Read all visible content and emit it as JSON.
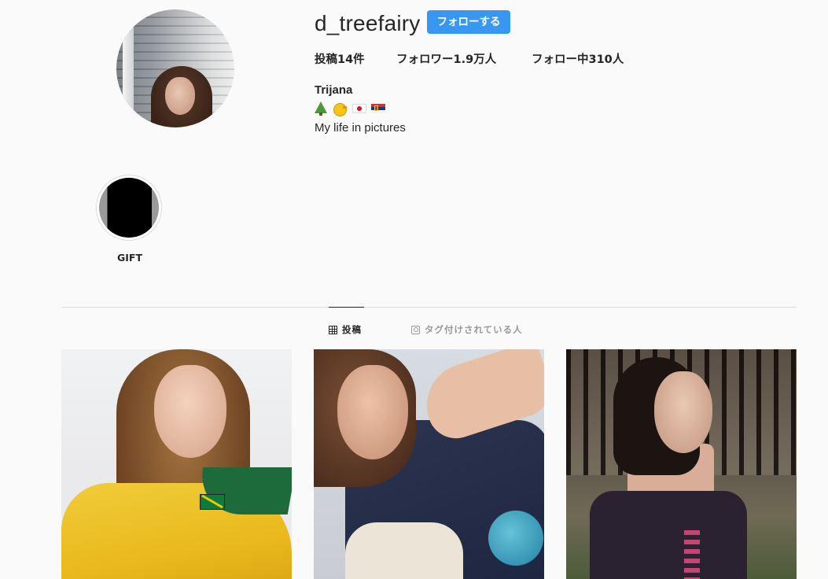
{
  "profile": {
    "username": "d_treefairy",
    "follow_label": "フォローする",
    "stats": {
      "posts": "投稿14件",
      "followers": "フォロワー1.9万人",
      "following": "フォロー中310人"
    },
    "full_name": "Trijana",
    "bio_emojis": [
      "tree-icon",
      "bird-icon",
      "flag-japan-icon",
      "flag-serbia-icon"
    ],
    "bio": "My life in pictures"
  },
  "highlights": [
    {
      "label": "GIFT"
    }
  ],
  "tabs": [
    {
      "label": "投稿",
      "icon": "grid-icon",
      "active": true
    },
    {
      "label": "タグ付けされている人",
      "icon": "tagged-icon",
      "active": false
    }
  ],
  "posts": [
    {
      "name": "post-1"
    },
    {
      "name": "post-2"
    },
    {
      "name": "post-3"
    }
  ],
  "colors": {
    "accent": "#3897f0",
    "background": "#fafafa",
    "text": "#262626",
    "muted": "#999999",
    "divider": "#dbdbdb"
  }
}
